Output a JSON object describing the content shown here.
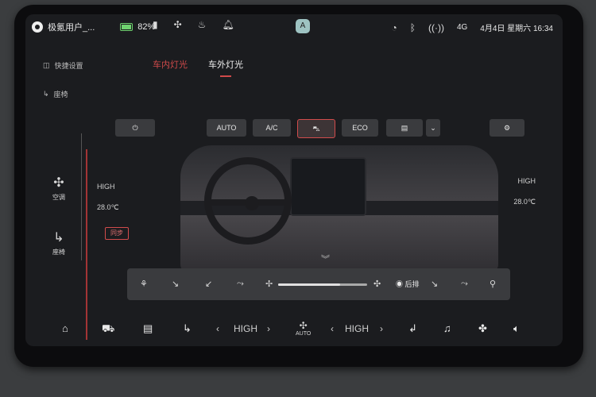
{
  "status": {
    "user_name": "极氪用户_...",
    "battery_percent": "82%",
    "battery_level": 0.82,
    "signal_label": "4G",
    "datetime": "4月4日 星期六 16:34",
    "top_badge": "A"
  },
  "sidebar": {
    "quick_settings": "快捷设置",
    "seat": "座椅",
    "climate_tab": "空调",
    "seat_tab": "座椅"
  },
  "tabs": [
    {
      "label": "车内灯光"
    },
    {
      "label": "车外灯光"
    }
  ],
  "controls": {
    "power": "⏻",
    "auto": "AUTO",
    "ac": "A/C",
    "eco": "ECO"
  },
  "zones": {
    "left_fan": "HIGH",
    "left_temp": "28.0℃",
    "sync": "同步",
    "right_fan": "HIGH",
    "right_temp": "28.0℃"
  },
  "fanbar": {
    "rear_label": "后排",
    "fan_level": 0.7
  },
  "dock": {
    "left_value": "HIGH",
    "right_value": "HIGH",
    "auto_label": "AUTO"
  },
  "colors": {
    "accent": "#d24c4c",
    "battery": "#6fd36f"
  }
}
